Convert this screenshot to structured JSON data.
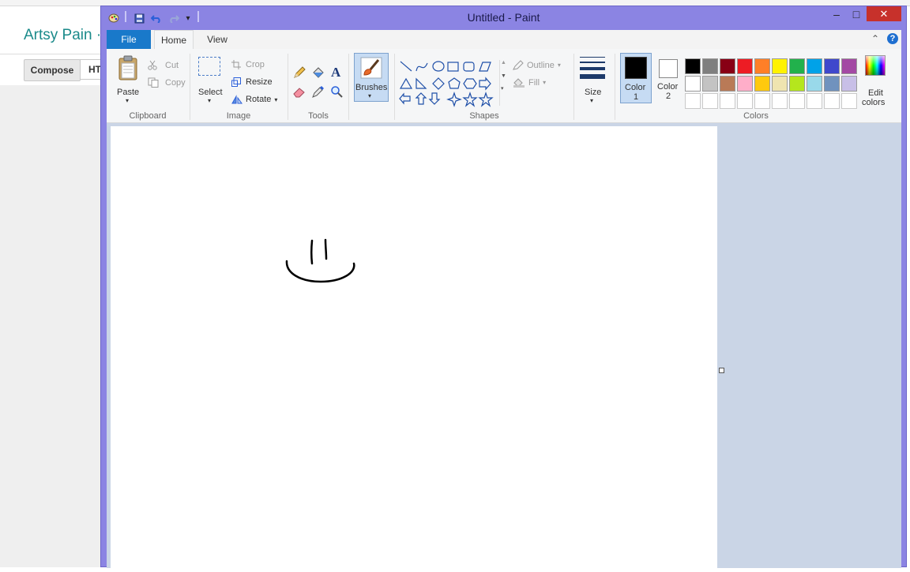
{
  "background": {
    "site_title": "Artsy Pain ·",
    "compose_label": "Compose",
    "html_label": "HT"
  },
  "window": {
    "title": "Untitled - Paint",
    "close_symbol": "✕",
    "minimize_symbol": "–",
    "maximize_symbol": "□"
  },
  "tabs": {
    "file": "File",
    "home": "Home",
    "view": "View",
    "collapse_symbol": "⌃",
    "help_symbol": "?"
  },
  "ribbon": {
    "clipboard": {
      "paste": "Paste",
      "cut": "Cut",
      "copy": "Copy",
      "group": "Clipboard"
    },
    "image": {
      "select": "Select",
      "crop": "Crop",
      "resize": "Resize",
      "rotate": "Rotate",
      "group": "Image"
    },
    "tools": {
      "group": "Tools",
      "text_symbol": "A"
    },
    "brushes": {
      "label": "Brushes"
    },
    "shapes": {
      "outline": "Outline",
      "fill": "Fill",
      "group": "Shapes"
    },
    "size": {
      "label": "Size"
    },
    "colors": {
      "color1_line1": "Color",
      "color1_line2": "1",
      "color2_line1": "Color",
      "color2_line2": "2",
      "edit_line1": "Edit",
      "edit_line2": "colors",
      "group": "Colors",
      "color1": "#000000",
      "color2": "#ffffff",
      "palette": [
        "#000000",
        "#7f7f7f",
        "#880015",
        "#ed1c24",
        "#ff7f27",
        "#fff200",
        "#22b14c",
        "#00a2e8",
        "#3f48cc",
        "#a349a4",
        "#ffffff",
        "#c3c3c3",
        "#b97a57",
        "#ffaec9",
        "#ffc90e",
        "#efe4b0",
        "#b5e61d",
        "#99d9ea",
        "#7092be",
        "#c8bfe7",
        "#ffffff",
        "#ffffff",
        "#ffffff",
        "#ffffff",
        "#ffffff",
        "#ffffff",
        "#ffffff",
        "#ffffff",
        "#ffffff",
        "#ffffff"
      ]
    }
  },
  "icons": {
    "quick_access": [
      "save-icon",
      "undo-icon",
      "redo-icon",
      "customize-icon"
    ],
    "tools": [
      "pencil-icon",
      "fill-bucket-icon",
      "text-icon",
      "eraser-icon",
      "color-picker-icon",
      "magnifier-icon"
    ]
  },
  "canvas": {
    "drawing": "smiley face sketch"
  }
}
